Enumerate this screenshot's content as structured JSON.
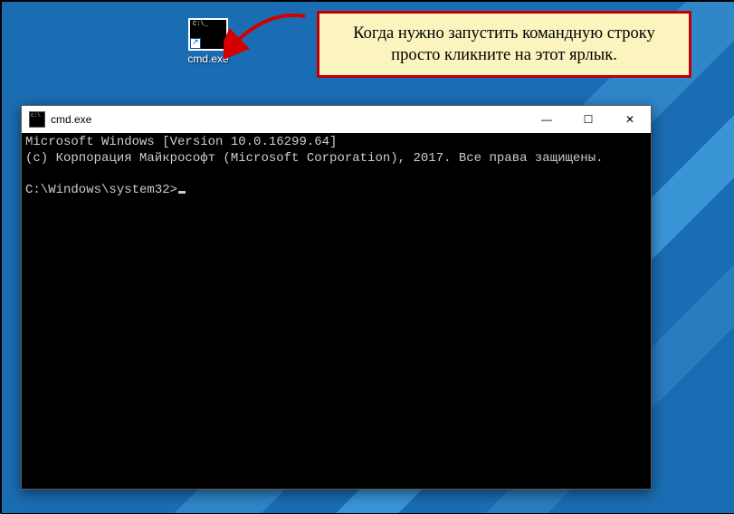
{
  "desktop": {
    "shortcut_label": "cmd.exe"
  },
  "callout": {
    "text": "Когда нужно запустить командную строку просто кликните на этот ярлык."
  },
  "cmd_window": {
    "title": "cmd.exe",
    "controls": {
      "minimize": "—",
      "maximize": "☐",
      "close": "✕"
    },
    "output": {
      "line1": "Microsoft Windows [Version 10.0.16299.64]",
      "line2": "(c) Корпорация Майкрософт (Microsoft Corporation), 2017. Все права защищены.",
      "blank": "",
      "prompt": "C:\\Windows\\system32>"
    }
  }
}
